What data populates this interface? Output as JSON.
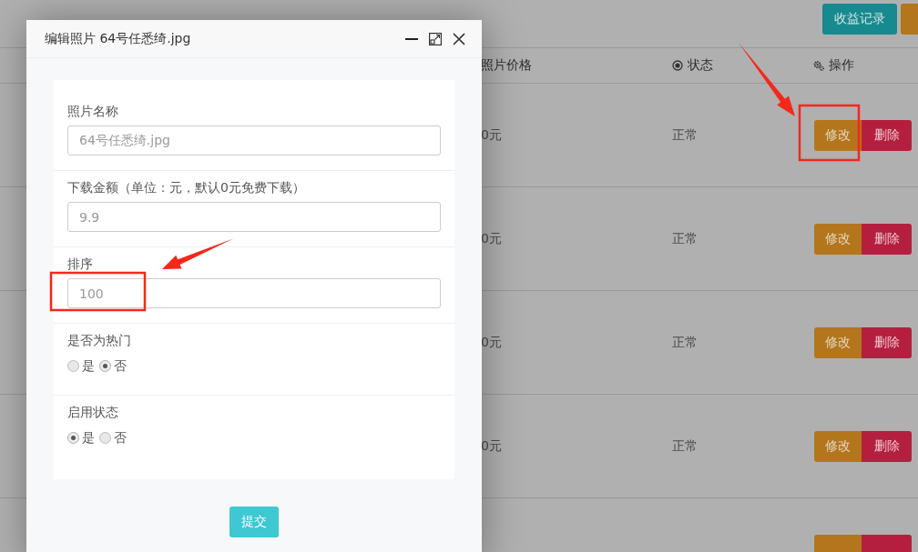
{
  "toolbar": {
    "buttons": [
      {
        "kind": "info",
        "label": "收益记录"
      },
      {
        "kind": "warning"
      }
    ]
  },
  "table": {
    "columns": [
      {
        "kind": "plain",
        "label": "照片价格"
      },
      {
        "kind": "status",
        "label": "状态"
      },
      {
        "kind": "actions",
        "label": "操作"
      }
    ],
    "rows": [
      {
        "price": "0元",
        "status": "正常",
        "actions": [
          {
            "kind": "edit",
            "label": "修改"
          },
          {
            "kind": "delete",
            "label": "删除"
          }
        ]
      },
      {
        "price": "0元",
        "status": "正常",
        "actions": [
          {
            "kind": "edit",
            "label": "修改"
          },
          {
            "kind": "delete",
            "label": "删除"
          }
        ]
      },
      {
        "price": "0元",
        "status": "正常",
        "actions": [
          {
            "kind": "edit",
            "label": "修改"
          },
          {
            "kind": "delete",
            "label": "删除"
          }
        ]
      },
      {
        "price": "0元",
        "status": "正常",
        "actions": [
          {
            "kind": "edit",
            "label": "修改"
          },
          {
            "kind": "delete",
            "label": "删除"
          }
        ]
      },
      {
        "actions": [
          {
            "kind": "edit"
          },
          {
            "kind": "delete"
          }
        ]
      }
    ]
  },
  "dialog": {
    "title": "编辑照片 64号任悉绮.jpg",
    "fields": [
      {
        "kind": "text",
        "label": "照片名称",
        "value": "64号任悉绮.jpg"
      },
      {
        "kind": "text",
        "label": "下载金额（单位：元，默认0元免费下载）",
        "value": "9.9"
      },
      {
        "kind": "text",
        "label": "排序",
        "value": "100"
      },
      {
        "kind": "radio",
        "label": "是否为热门",
        "options": [
          {
            "label": "是",
            "selected": false
          },
          {
            "label": "否",
            "selected": true
          }
        ]
      },
      {
        "kind": "radio",
        "label": "启用状态",
        "options": [
          {
            "label": "是",
            "selected": true
          },
          {
            "label": "否",
            "selected": false
          }
        ]
      }
    ],
    "submit": "提交"
  }
}
